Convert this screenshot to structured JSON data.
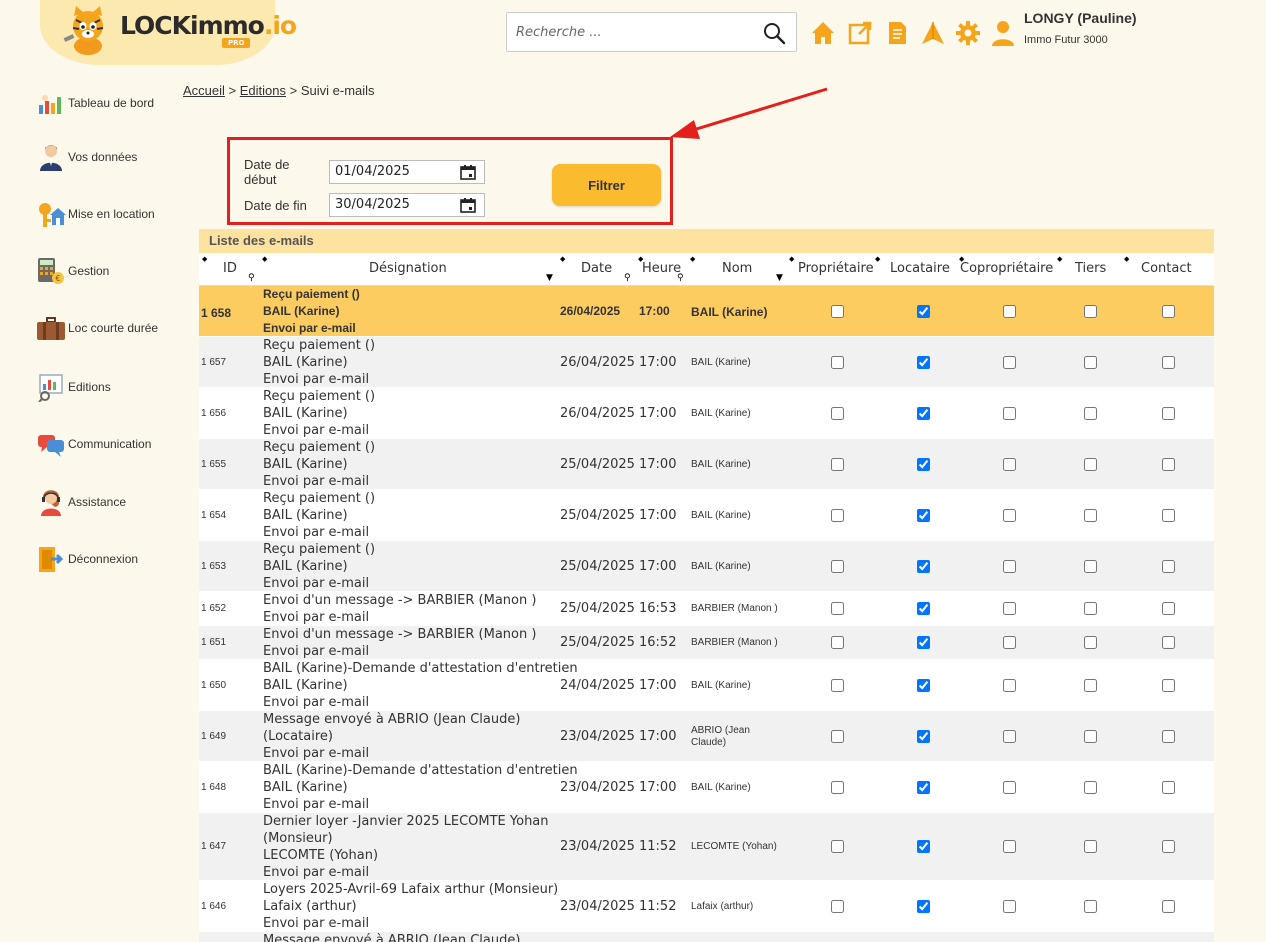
{
  "brand": {
    "name_main": "LOCKimmo",
    "name_suffix": ".io",
    "badge": "PRO",
    "accent": "#f4a51c"
  },
  "search": {
    "placeholder": "Recherche ..."
  },
  "header_icons": [
    "home-icon",
    "external-link-icon",
    "document-icon",
    "paper-plane-icon",
    "gear-icon",
    "user-icon"
  ],
  "user": {
    "name": "LONGY (Pauline)",
    "agency": "Immo Futur 3000"
  },
  "sidebar": {
    "items": [
      {
        "label": "Tableau de bord",
        "icon": "dashboard-icon"
      },
      {
        "label": "Vos données",
        "icon": "person-icon"
      },
      {
        "label": "Mise en location",
        "icon": "house-key-icon"
      },
      {
        "label": "Gestion",
        "icon": "calculator-icon"
      },
      {
        "label": "Loc courte durée",
        "icon": "suitcase-icon"
      },
      {
        "label": "Editions",
        "icon": "editions-icon"
      },
      {
        "label": "Communication",
        "icon": "chat-icon"
      },
      {
        "label": "Assistance",
        "icon": "headset-icon"
      },
      {
        "label": "Déconnexion",
        "icon": "logout-door-icon"
      }
    ]
  },
  "breadcrumb": {
    "home": "Accueil",
    "sep": ">",
    "section": "Editions",
    "current": "Suivi e-mails"
  },
  "filter": {
    "start_label": "Date de début",
    "start_value": "01/04/2025",
    "end_label": "Date de fin",
    "end_value": "30/04/2025",
    "button": "Filtrer"
  },
  "list": {
    "title": "Liste des e-mails",
    "columns": [
      "ID",
      "Désignation",
      "Date",
      "Heure",
      "Nom",
      "Propriétaire",
      "Locataire",
      "Copropriétaire",
      "Tiers",
      "Contact"
    ],
    "rows": [
      {
        "id": "1 658",
        "designation": [
          "Reçu paiement ()",
          "BAIL (Karine)",
          "Envoi par e-mail"
        ],
        "date": "26/04/2025",
        "heure": "17:00",
        "nom": "BAIL (Karine)",
        "prop": false,
        "loc": true,
        "copr": false,
        "tiers": false,
        "contact": false,
        "selected": true
      },
      {
        "id": "1 657",
        "designation": [
          "Reçu paiement ()",
          "BAIL (Karine)",
          "Envoi par e-mail"
        ],
        "date": "26/04/2025",
        "heure": "17:00",
        "nom": "BAIL (Karine)",
        "prop": false,
        "loc": true,
        "copr": false,
        "tiers": false,
        "contact": false
      },
      {
        "id": "1 656",
        "designation": [
          "Reçu paiement ()",
          "BAIL (Karine)",
          "Envoi par e-mail"
        ],
        "date": "26/04/2025",
        "heure": "17:00",
        "nom": "BAIL (Karine)",
        "prop": false,
        "loc": true,
        "copr": false,
        "tiers": false,
        "contact": false
      },
      {
        "id": "1 655",
        "designation": [
          "Reçu paiement ()",
          "BAIL (Karine)",
          "Envoi par e-mail"
        ],
        "date": "25/04/2025",
        "heure": "17:00",
        "nom": "BAIL (Karine)",
        "prop": false,
        "loc": true,
        "copr": false,
        "tiers": false,
        "contact": false
      },
      {
        "id": "1 654",
        "designation": [
          "Reçu paiement ()",
          "BAIL (Karine)",
          "Envoi par e-mail"
        ],
        "date": "25/04/2025",
        "heure": "17:00",
        "nom": "BAIL (Karine)",
        "prop": false,
        "loc": true,
        "copr": false,
        "tiers": false,
        "contact": false
      },
      {
        "id": "1 653",
        "designation": [
          "Reçu paiement ()",
          "BAIL (Karine)",
          "Envoi par e-mail"
        ],
        "date": "25/04/2025",
        "heure": "17:00",
        "nom": "BAIL (Karine)",
        "prop": false,
        "loc": true,
        "copr": false,
        "tiers": false,
        "contact": false
      },
      {
        "id": "1 652",
        "designation": [
          "Envoi d'un message -> BARBIER (Manon )",
          "Envoi par e-mail"
        ],
        "date": "25/04/2025",
        "heure": "16:53",
        "nom": "BARBIER (Manon )",
        "prop": false,
        "loc": true,
        "copr": false,
        "tiers": false,
        "contact": false
      },
      {
        "id": "1 651",
        "designation": [
          "Envoi d'un message -> BARBIER (Manon )",
          "Envoi par e-mail"
        ],
        "date": "25/04/2025",
        "heure": "16:52",
        "nom": "BARBIER (Manon )",
        "prop": false,
        "loc": true,
        "copr": false,
        "tiers": false,
        "contact": false
      },
      {
        "id": "1 650",
        "designation": [
          "BAIL (Karine)-Demande d'attestation d'entretien",
          "BAIL (Karine)",
          "Envoi par e-mail"
        ],
        "date": "24/04/2025",
        "heure": "17:00",
        "nom": "BAIL (Karine)",
        "prop": false,
        "loc": true,
        "copr": false,
        "tiers": false,
        "contact": false
      },
      {
        "id": "1 649",
        "designation": [
          "Message envoyé à ABRIO (Jean Claude)",
          "(Locataire)",
          "Envoi par e-mail"
        ],
        "date": "23/04/2025",
        "heure": "17:00",
        "nom": "ABRIO (Jean Claude)",
        "prop": false,
        "loc": true,
        "copr": false,
        "tiers": false,
        "contact": false
      },
      {
        "id": "1 648",
        "designation": [
          "BAIL (Karine)-Demande d'attestation d'entretien",
          "BAIL (Karine)",
          "Envoi par e-mail"
        ],
        "date": "23/04/2025",
        "heure": "17:00",
        "nom": "BAIL (Karine)",
        "prop": false,
        "loc": true,
        "copr": false,
        "tiers": false,
        "contact": false
      },
      {
        "id": "1 647",
        "designation": [
          "Dernier loyer -Janvier 2025 LECOMTE Yohan",
          "(Monsieur)",
          "LECOMTE (Yohan)",
          "Envoi par e-mail"
        ],
        "date": "23/04/2025",
        "heure": "11:52",
        "nom": "LECOMTE (Yohan)",
        "prop": false,
        "loc": true,
        "copr": false,
        "tiers": false,
        "contact": false
      },
      {
        "id": "1 646",
        "designation": [
          "Loyers 2025-Avril-69 Lafaix arthur (Monsieur)",
          "Lafaix (arthur)",
          "Envoi par e-mail"
        ],
        "date": "23/04/2025",
        "heure": "11:52",
        "nom": "Lafaix (arthur)",
        "prop": false,
        "loc": true,
        "copr": false,
        "tiers": false,
        "contact": false
      },
      {
        "id": "",
        "designation": [
          "Message envoyé à ABRIO (Jean Claude)"
        ],
        "date": "",
        "heure": "",
        "nom": "",
        "prop": false,
        "loc": false,
        "copr": false,
        "tiers": false,
        "contact": false,
        "partial": true
      }
    ]
  }
}
